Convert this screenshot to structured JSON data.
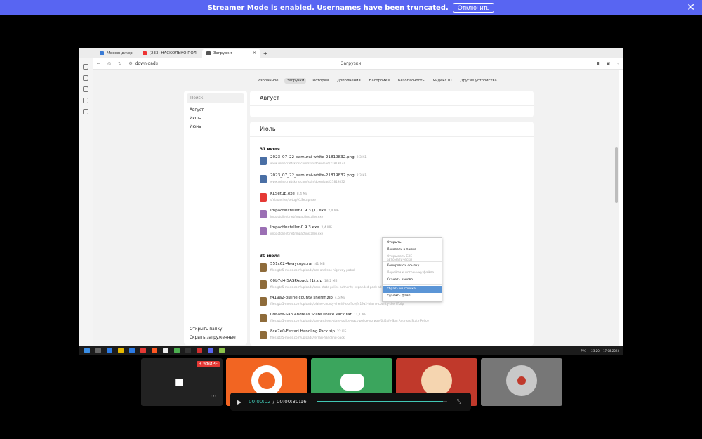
{
  "banner": {
    "text": "Streamer Mode is enabled. Usernames have been truncated.",
    "button": "Отключить"
  },
  "browser": {
    "tabs": [
      {
        "label": "Мессенджер",
        "color": "#3a7bd5"
      },
      {
        "label": "(233) НАСКОЛЬКО ПОЛ",
        "color": "#e33"
      },
      {
        "label": "Загрузки",
        "color": "#555"
      }
    ],
    "address": "downloads",
    "page_title": "Загрузки"
  },
  "nav": [
    "Избранное",
    "Загрузки",
    "История",
    "Дополнения",
    "Настройки",
    "Безопасность",
    "Яндекс ID",
    "Другие устройства"
  ],
  "sidebar": {
    "search_placeholder": "Поиск",
    "months": [
      "Август",
      "Июль",
      "Июнь"
    ],
    "open_folder": "Открыть папку",
    "hide": "Скрыть загруженные"
  },
  "cards": {
    "august": "Август",
    "july": "Июль"
  },
  "days": {
    "d31": "31 июля",
    "d30": "30 июля"
  },
  "files": [
    {
      "name": "2023_07_22_samurai-white-21819832.png",
      "size": "2,3 КБ",
      "url": "www.minecraftskins.com/skin/download/21819832",
      "icon": "file-icon",
      "color": "#4a6fa5"
    },
    {
      "name": "2023_07_22_samurai-white-21819832.png",
      "size": "2,3 КБ",
      "url": "www.minecraftskins.com/skin/download/21819832",
      "icon": "file-icon",
      "color": "#4a6fa5"
    },
    {
      "name": "KLSetup.exe",
      "size": "8,4 МБ",
      "url": "sfxlauncher/setup/KLSetup.exe",
      "icon": "kl-icon",
      "color": "#e53935"
    },
    {
      "name": "ImpactInstaller-0.9.3 (1).exe",
      "size": "2,4 МБ",
      "url": "impactclient.net/impactinstaller.exe",
      "icon": "impact-icon",
      "color": "#9b6fb4"
    },
    {
      "name": "ImpactInstaller-0.9.3.exe",
      "size": "2,4 МБ",
      "url": "impactclient.net/impactinstaller.exe",
      "icon": "impact-icon",
      "color": "#9b6fb4"
    },
    {
      "name": "551c62-4waycops.rar",
      "size": "41 МБ",
      "url": "files.gta5-mods.com/uploads/san-andreas-highway-patrol",
      "icon": "rar-icon",
      "color": "#8e6b3a"
    },
    {
      "name": "00b7d4-SASPApack (1).zip",
      "size": "18,2 МБ",
      "url": "files.gta5-mods.com/uploads/sasp-state-police-authority-expanded-pack-add-on/00b7d4-SASPApack.zip",
      "icon": "zip-icon",
      "color": "#8e6b3a"
    },
    {
      "name": "f419a2-blaine county sheriff.zip",
      "size": "4,6 МБ",
      "url": "files.gta5-mods.com/uploads/blaine-county-sheriff-s-office/f419a2-blaine-county-sheriff.zip",
      "icon": "zip-icon",
      "color": "#8e6b3a"
    },
    {
      "name": "0d6afe-San Andreas State Police Pack.rar",
      "size": "11,1 МБ",
      "url": "files.gta5-mods.com/uploads/san-andreas-state-police-pack-police-norway/0d6afe-San Andreas State Police",
      "icon": "rar-icon",
      "color": "#8e6b3a"
    },
    {
      "name": "8ce7e0-Ferrari Handling Pack.zip",
      "size": "22 КБ",
      "url": "files.gta5-mods.com/uploads/ferrari-handling-pack",
      "icon": "zip-icon",
      "color": "#8e6b3a"
    }
  ],
  "context_menu": [
    {
      "label": "Открыть",
      "state": "normal"
    },
    {
      "label": "Показать в папке",
      "state": "normal"
    },
    {
      "label": "Открывать EXE автоматически",
      "state": "disabled"
    },
    {
      "label": "Копировать ссылку",
      "state": "normal"
    },
    {
      "label": "Перейти к источнику файла",
      "state": "disabled"
    },
    {
      "label": "Скачать заново",
      "state": "normal"
    },
    {
      "label": "Убрать из списка",
      "state": "highlighted"
    },
    {
      "label": "Удалить файл",
      "state": "normal"
    }
  ],
  "taskbar": {
    "lang": "РУС",
    "time": "23:20",
    "date": "17.08.2023"
  },
  "thumbs": {
    "live_badge": "В ЭФИРЕ"
  },
  "player": {
    "current": "00:00:02",
    "sep": "/",
    "total": "00:00:30:16",
    "progress": 0.97
  }
}
